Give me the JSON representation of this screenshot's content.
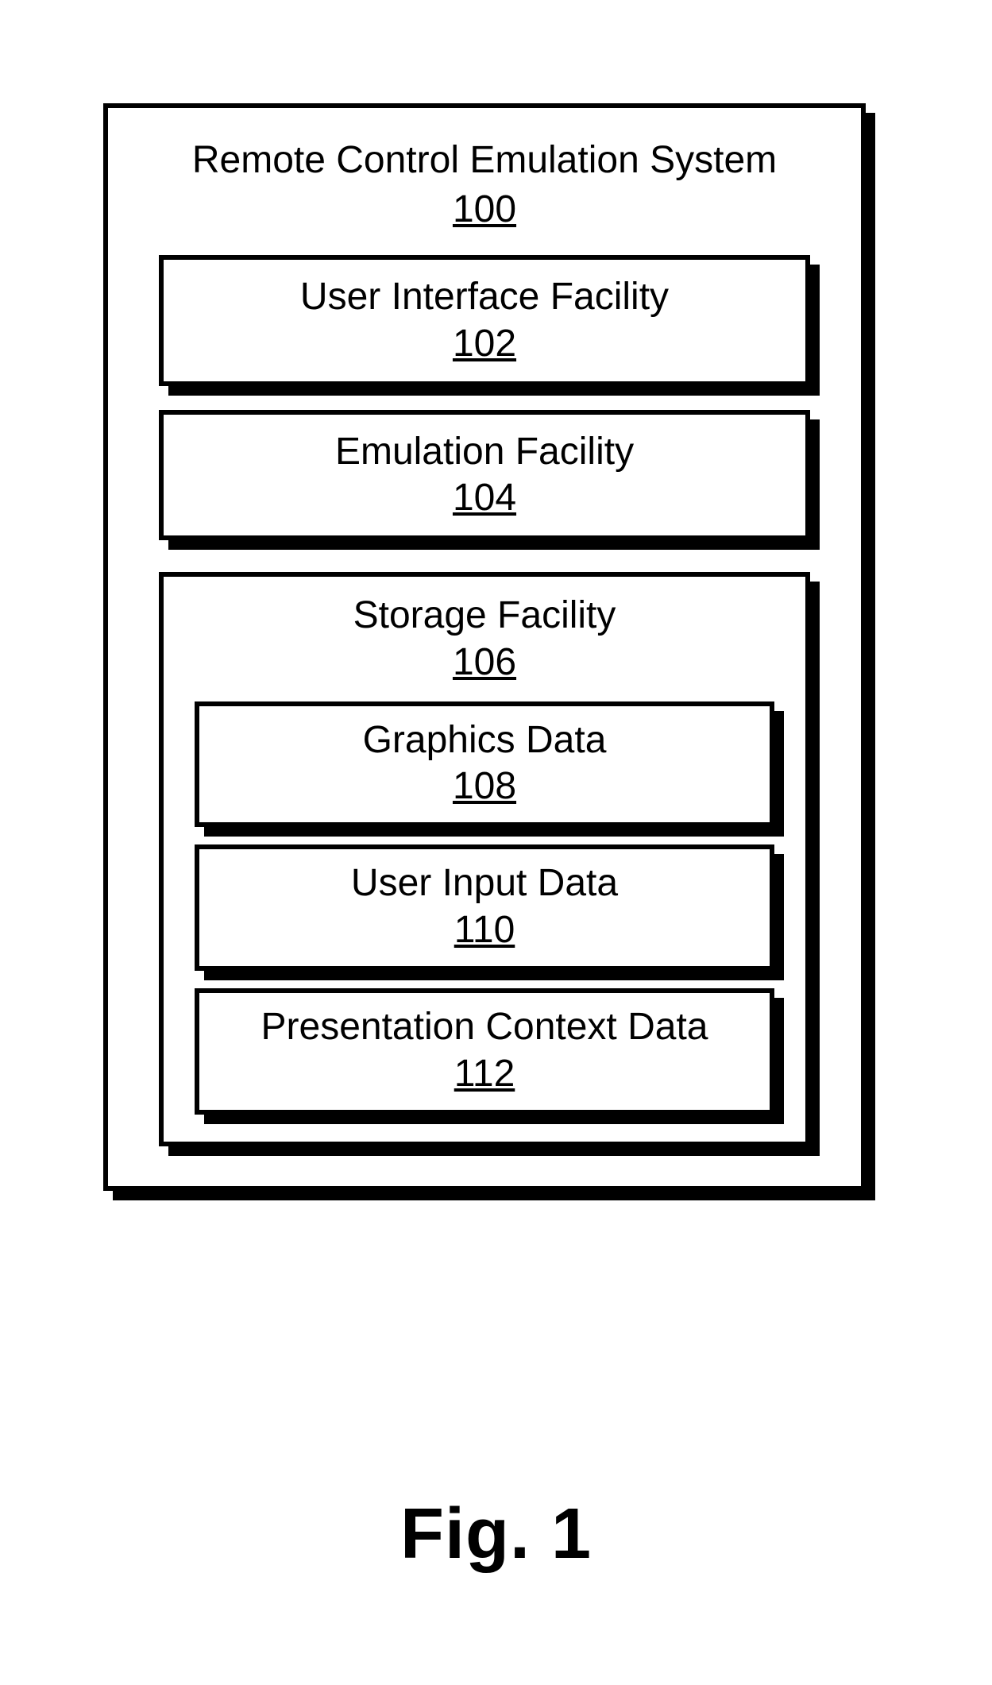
{
  "figure_caption": "Fig. 1",
  "system": {
    "title": "Remote Control Emulation System",
    "ref": "100",
    "blocks": [
      {
        "title": "User Interface Facility",
        "ref": "102"
      },
      {
        "title": "Emulation Facility",
        "ref": "104"
      }
    ],
    "storage": {
      "title": "Storage Facility",
      "ref": "106",
      "items": [
        {
          "title": "Graphics Data",
          "ref": "108"
        },
        {
          "title": "User Input Data",
          "ref": "110"
        },
        {
          "title": "Presentation Context Data",
          "ref": "112"
        }
      ]
    }
  }
}
